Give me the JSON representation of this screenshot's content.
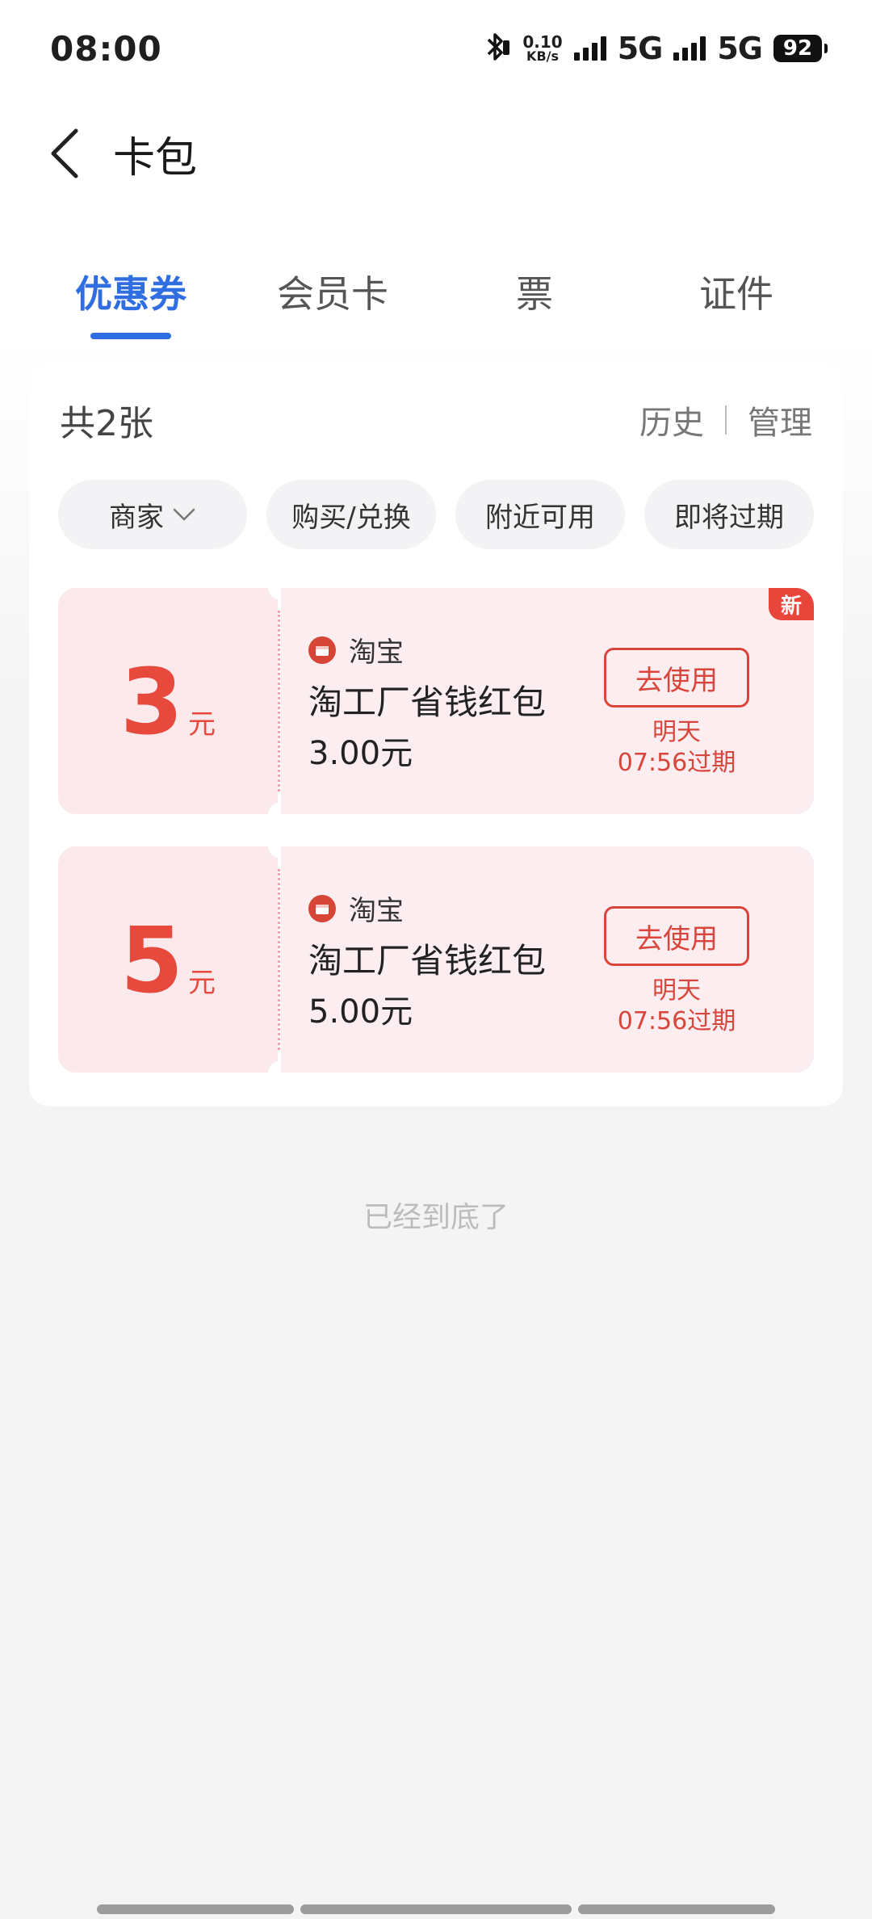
{
  "status_bar": {
    "time": "08:00",
    "net_speed_value": "0.10",
    "net_speed_unit": "KB/s",
    "network_1": "5G",
    "network_2": "5G",
    "battery": "92"
  },
  "header": {
    "title": "卡包"
  },
  "tabs": [
    {
      "label": "优惠券",
      "active": true
    },
    {
      "label": "会员卡",
      "active": false
    },
    {
      "label": "票",
      "active": false
    },
    {
      "label": "证件",
      "active": false
    }
  ],
  "summary": {
    "count_label": "共2张",
    "history": "历史",
    "manage": "管理"
  },
  "filters": [
    {
      "label": "商家"
    },
    {
      "label": "购买/兑换"
    },
    {
      "label": "附近可用"
    },
    {
      "label": "即将过期"
    }
  ],
  "coupons": [
    {
      "amount": "3",
      "unit": "元",
      "merchant": "淘宝",
      "title": "淘工厂省钱红包",
      "value": "3.00元",
      "action": "去使用",
      "expire_line1": "明天",
      "expire_line2": "07:56过期",
      "badge": "新"
    },
    {
      "amount": "5",
      "unit": "元",
      "merchant": "淘宝",
      "title": "淘工厂省钱红包",
      "value": "5.00元",
      "action": "去使用",
      "expire_line1": "明天",
      "expire_line2": "07:56过期"
    }
  ],
  "footer": {
    "end_text": "已经到底了"
  },
  "colors": {
    "accent": "#2f6de1",
    "coupon_red": "#e7493d",
    "coupon_bg": "#fcedf0"
  }
}
